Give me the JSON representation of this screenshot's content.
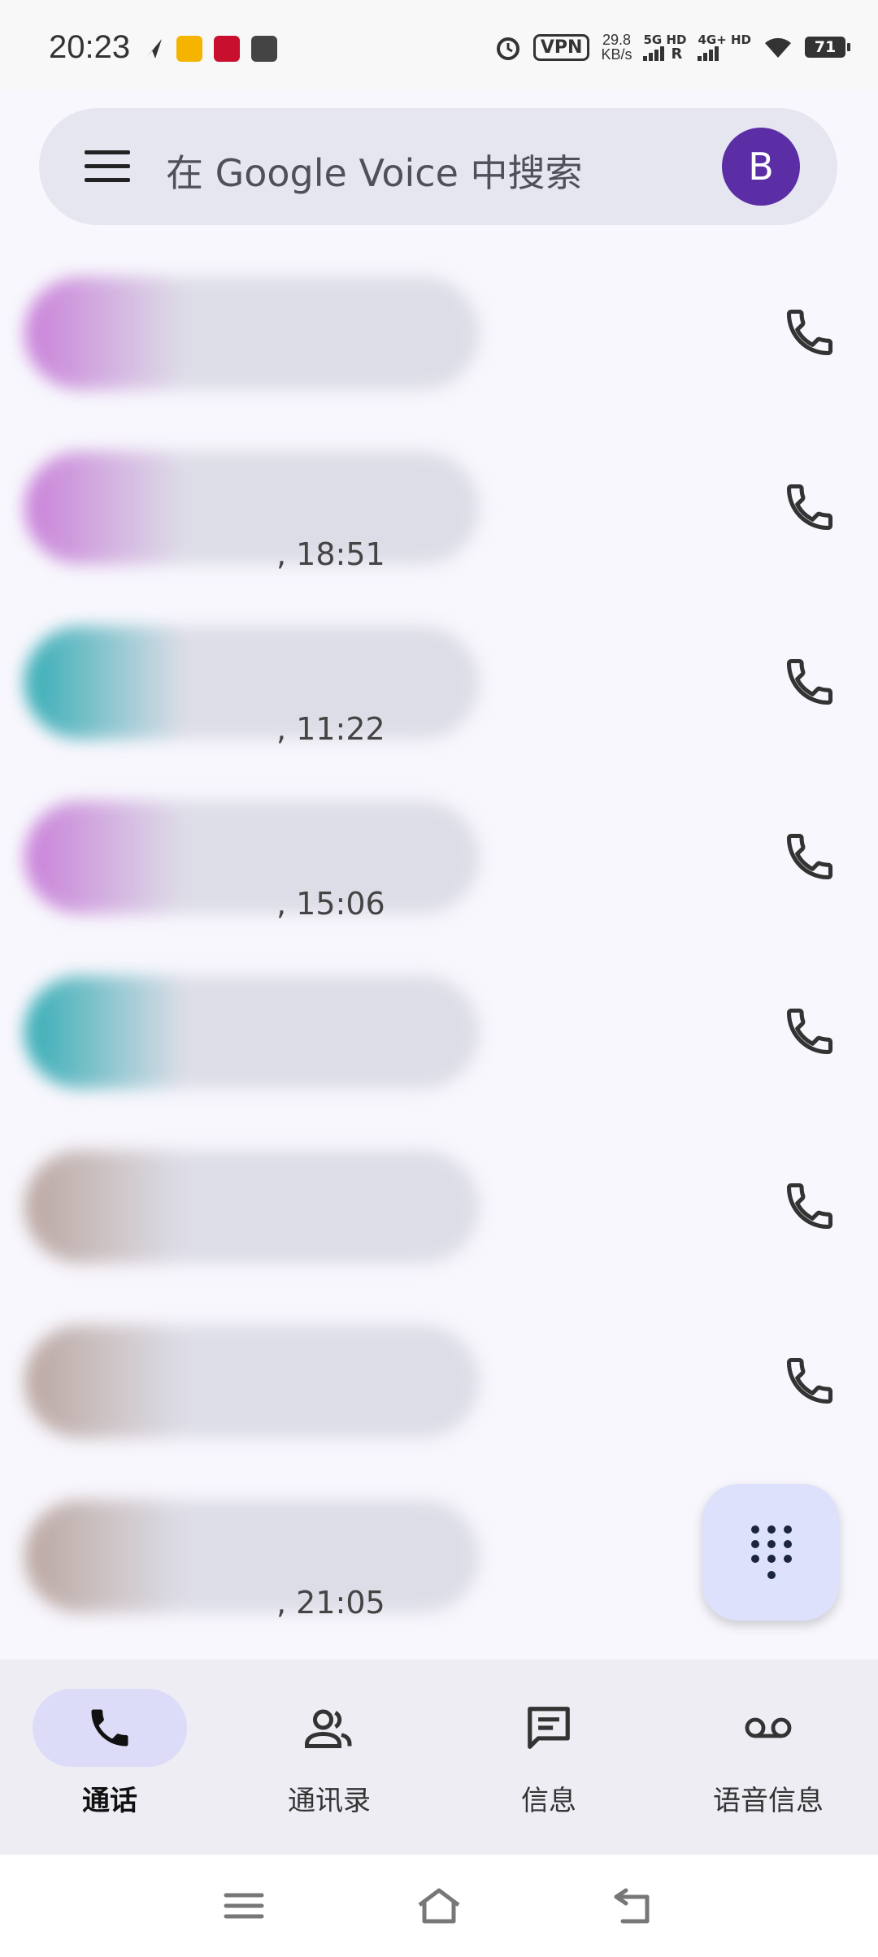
{
  "status_bar": {
    "time": "20:23",
    "vpn": "VPN",
    "speed_value": "29.8",
    "speed_unit": "KB/s",
    "net1": "5G HD",
    "net1_sub": "R",
    "net2": "4G+ HD",
    "battery": "71",
    "icons": [
      "alarm-icon",
      "wifi-icon",
      "signal-icon"
    ]
  },
  "search": {
    "placeholder": "在 Google Voice 中搜索",
    "avatar_letter": "B",
    "avatar_color": "#5b2ea6"
  },
  "calls": [
    {
      "blur_colors": [
        "#c77ad8",
        "#dcdce6"
      ],
      "time": ""
    },
    {
      "blur_colors": [
        "#c77ad8",
        "#dcdce6"
      ],
      "time": ", 18:51"
    },
    {
      "blur_colors": [
        "#2aa9b2",
        "#dcdce6"
      ],
      "time": ", 11:22"
    },
    {
      "blur_colors": [
        "#c77ad8",
        "#dcdce6"
      ],
      "time": ", 15:06"
    },
    {
      "blur_colors": [
        "#2aa9b2",
        "#dcdce6"
      ],
      "time": ""
    },
    {
      "blur_colors": [
        "#b8a39c",
        "#dcdce6"
      ],
      "time": ""
    },
    {
      "blur_colors": [
        "#b8a39c",
        "#dcdce6"
      ],
      "time": ""
    },
    {
      "blur_colors": [
        "#b8a39c",
        "#dcdce6"
      ],
      "time": ", 21:05"
    }
  ],
  "bottom_nav": {
    "items": [
      {
        "label": "通话",
        "icon": "phone-icon",
        "active": true
      },
      {
        "label": "通讯录",
        "icon": "contacts-icon",
        "active": false
      },
      {
        "label": "信息",
        "icon": "message-icon",
        "active": false
      },
      {
        "label": "语音信息",
        "icon": "voicemail-icon",
        "active": false
      }
    ]
  },
  "colors": {
    "accent": "#5b2ea6",
    "fab_bg": "#dde1fb",
    "nav_active_bg": "#dcdcf8"
  }
}
